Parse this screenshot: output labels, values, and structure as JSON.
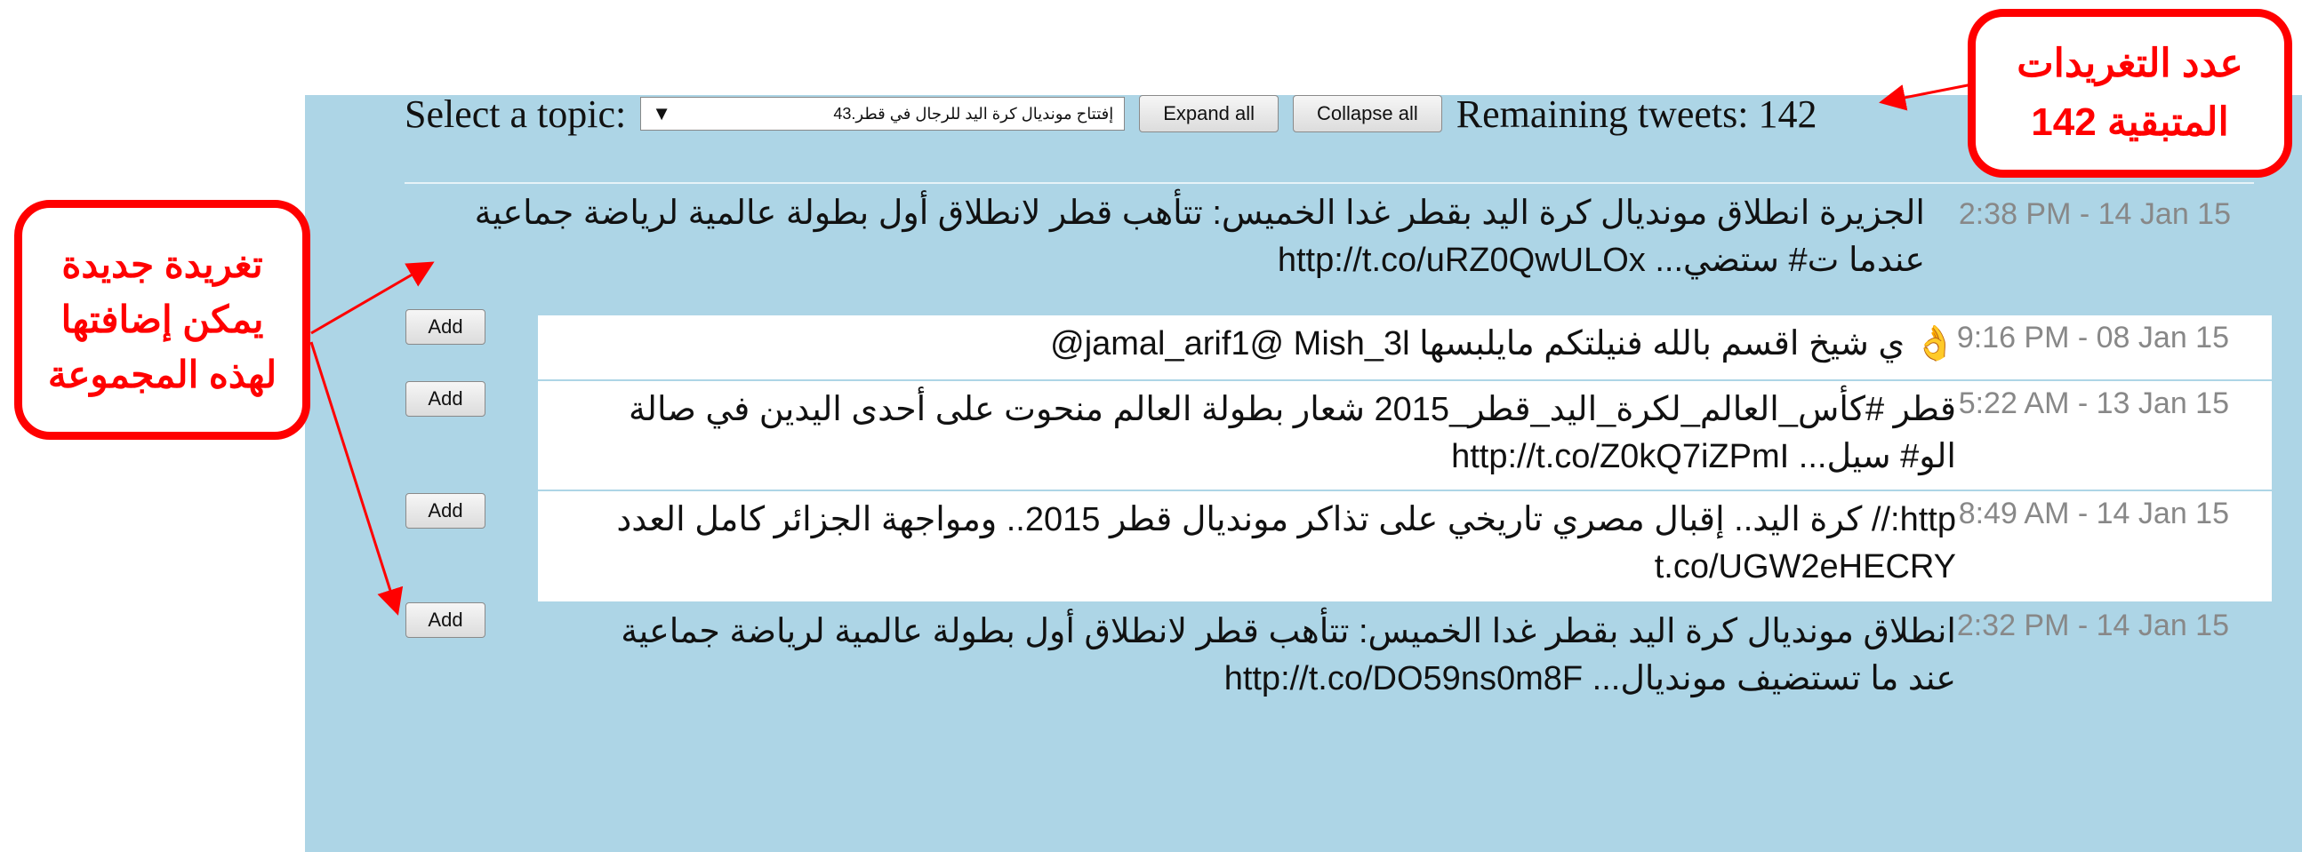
{
  "header": {
    "topic_label": "Select a topic:",
    "topic_selected": "إفتتاح مونديال كرة اليد للرجال في قطر.43",
    "expand_label": "Expand all",
    "collapse_label": "Collapse all",
    "remaining_label": "Remaining tweets: 142"
  },
  "current_tweet": {
    "text": "الجزيرة انطلاق مونديال كرة اليد بقطر غدا الخميس: تتأهب قطر لانطلاق أول بطولة عالمية لرياضة جماعية عندما ت# ستضي... http://t.co/uRZ0QwULOx",
    "time": "2:38 PM - 14 Jan 15"
  },
  "candidate_tweets": [
    {
      "text": "👌 ي شيخ اقسم بالله فنيلتكم مايلبسها jamal_arif1@ Mish_3l@",
      "time": "9:16 PM - 08 Jan 15",
      "add_label": "Add"
    },
    {
      "text": "قطر #كأس_العالم_لكرة_اليد_قطر_2015 شعار بطولة العالم منحوت على أحدى اليدين في صالة الو# سيل... http://t.co/Z0kQ7iZPmI",
      "time": "5:22 AM - 13 Jan 15",
      "add_label": "Add"
    },
    {
      "text": "http:// كرة اليد.. إقبال مصري تاريخي على تذاكر مونديال قطر 2015.. ومواجهة الجزائر كامل العدد t.co/UGW2eHECRY",
      "time": "8:49 AM - 14 Jan 15",
      "add_label": "Add"
    },
    {
      "text": "انطلاق مونديال كرة اليد بقطر غدا الخميس: تتأهب قطر لانطلاق أول بطولة عالمية لرياضة جماعية عند ما تستضيف مونديال... http://t.co/DO59ns0m8F",
      "time": "2:32 PM - 14 Jan 15",
      "add_label": "Add"
    }
  ],
  "annotations": {
    "remaining_note": [
      "عدد التغريدات",
      "المتبقية 142"
    ],
    "add_note": [
      "تغريدة جديدة",
      "يمكن إضافتها",
      "لهذه المجموعة"
    ]
  },
  "colors": {
    "panel_bg": "#add5e6",
    "callout_red": "#ff0000",
    "time_gray": "#888888"
  }
}
